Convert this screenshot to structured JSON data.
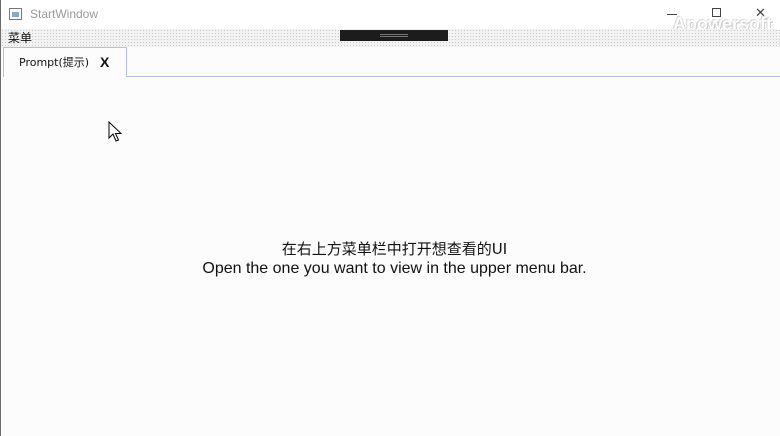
{
  "window": {
    "title": "StartWindow",
    "close_glyph": "✕",
    "watermark": "Apowersoft"
  },
  "menubar": {
    "menu_label": "菜单"
  },
  "tabs": [
    {
      "label": "Prompt(提示)",
      "close_label": "X"
    }
  ],
  "content": {
    "message_cn": "在右上方菜单栏中打开想查看的UI",
    "message_en": "Open the one you want to view in the upper menu bar."
  },
  "icons": {
    "app": "app-window-icon",
    "cursor": "mouse-pointer-icon"
  },
  "colors": {
    "background": "#fcfcfd",
    "tab_border": "#b8bde6",
    "drag_bar": "#1c1c1c"
  }
}
